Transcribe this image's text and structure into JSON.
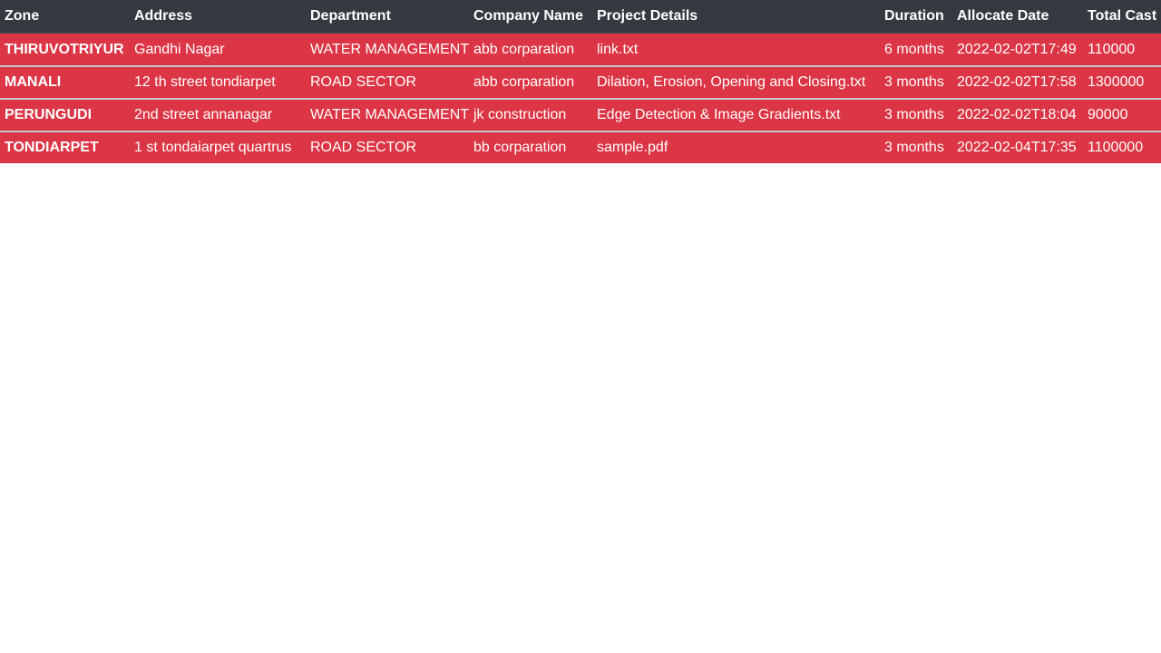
{
  "table": {
    "headers": [
      "Zone",
      "Address",
      "Department",
      "Company Name",
      "Project Details",
      "Duration",
      "Allocate Date",
      "Total Cast"
    ],
    "rows": [
      [
        "THIRUVOTRIYUR",
        "Gandhi Nagar",
        "WATER MANAGEMENT",
        "abb corparation",
        "link.txt",
        "6 months",
        "2022-02-02T17:49",
        "110000"
      ],
      [
        "MANALI",
        "12 th street tondiarpet",
        "ROAD SECTOR",
        "abb corparation",
        "Dilation, Erosion, Opening and Closing.txt",
        "3 months",
        "2022-02-02T17:58",
        "1300000"
      ],
      [
        "PERUNGUDI",
        "2nd street annanagar",
        "WATER MANAGEMENT",
        "jk construction",
        "Edge Detection & Image Gradients.txt",
        "3 months",
        "2022-02-02T18:04",
        "90000"
      ],
      [
        "TONDIARPET",
        "1 st tondaiarpet quartrus",
        "ROAD SECTOR",
        "bb corparation",
        "sample.pdf",
        "3 months",
        "2022-02-04T17:35",
        "1100000"
      ]
    ]
  },
  "colors": {
    "header_bg": "#343a40",
    "row_bg": "#dc3545",
    "text": "#ffffff"
  }
}
